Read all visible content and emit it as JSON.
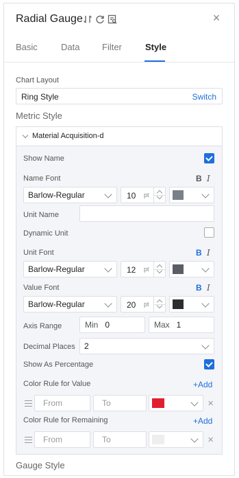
{
  "header": {
    "title": "Radial Gauge",
    "close": "×"
  },
  "tabs": [
    {
      "label": "Basic",
      "active": false
    },
    {
      "label": "Data",
      "active": false
    },
    {
      "label": "Filter",
      "active": false
    },
    {
      "label": "Style",
      "active": true
    }
  ],
  "chart_layout": {
    "label": "Chart Layout",
    "value": "Ring Style",
    "switch_label": "Switch"
  },
  "metric_style": {
    "label": "Metric Style",
    "group_title": "Material Acquisition-d",
    "show_name": {
      "label": "Show Name",
      "checked": true
    },
    "name_font": {
      "label": "Name Font",
      "family": "Barlow-Regular",
      "size": "10",
      "unit": "pt",
      "color": "#7a7f8a",
      "bold": "B",
      "italic": "I",
      "bold_active": false
    },
    "unit_name": {
      "label": "Unit Name",
      "value": ""
    },
    "dynamic_unit": {
      "label": "Dynamic Unit",
      "checked": false
    },
    "unit_font": {
      "label": "Unit Font",
      "family": "Barlow-Regular",
      "size": "12",
      "unit": "pt",
      "color": "#5a5d66",
      "bold": "B",
      "italic": "I",
      "bold_active": true
    },
    "value_font": {
      "label": "Value Font",
      "family": "Barlow-Regular",
      "size": "20",
      "unit": "pt",
      "color": "#2c2d31",
      "bold": "B",
      "italic": "I",
      "bold_active": true
    },
    "axis_range": {
      "label": "Axis Range",
      "min_label": "Min",
      "min_value": "0",
      "max_label": "Max",
      "max_value": "1"
    },
    "decimal_places": {
      "label": "Decimal Places",
      "value": "2"
    },
    "show_as_percentage": {
      "label": "Show As Percentage",
      "checked": true
    },
    "color_rule_value": {
      "label": "Color Rule for Value",
      "add_label": "+Add",
      "from_placeholder": "From",
      "to_placeholder": "To",
      "color": "#e0202e"
    },
    "color_rule_remaining": {
      "label": "Color Rule for Remaining",
      "add_label": "+Add",
      "from_placeholder": "From",
      "to_placeholder": "To",
      "color": "#eeeeee"
    }
  },
  "gauge_style": {
    "label": "Gauge Style"
  }
}
